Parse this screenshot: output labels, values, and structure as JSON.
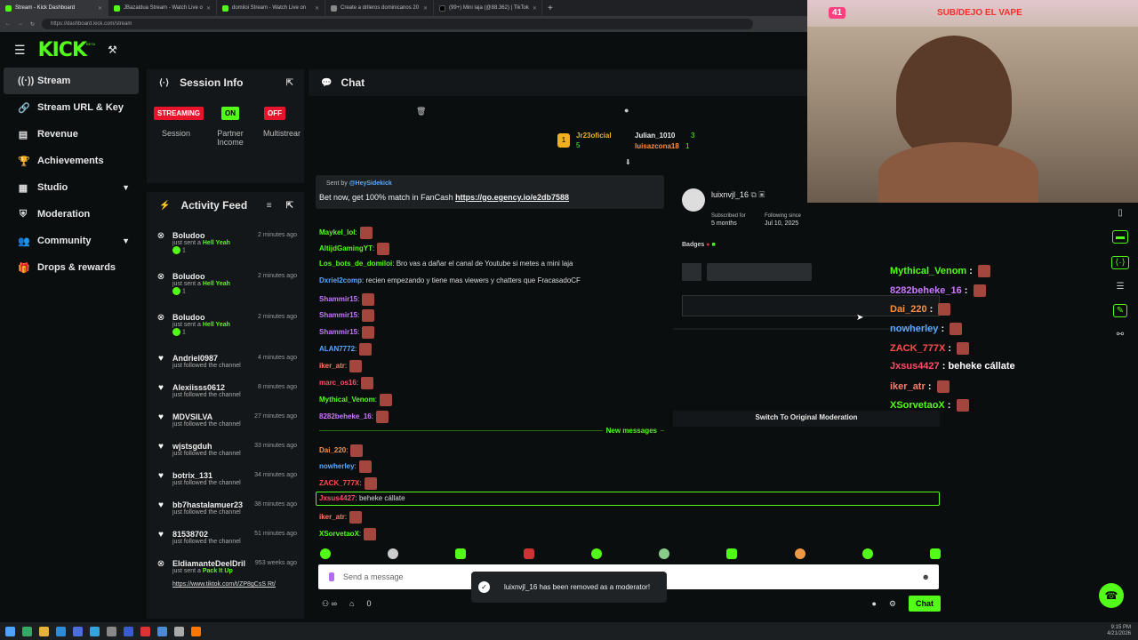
{
  "browser": {
    "tabs": [
      {
        "label": "Stream - Kick Dashboard"
      },
      {
        "label": "JBazaldua Stream - Watch Live o"
      },
      {
        "label": "domiloi Stream - Watch Live on"
      },
      {
        "label": "Create a drileros dominicanos 20"
      },
      {
        "label": "(99+) Mini laja (@88.362) | TikTok"
      }
    ],
    "url": "https://dashboard.kick.com/stream"
  },
  "topnav": {
    "logo": "KICK",
    "beta": "BETA"
  },
  "sidebar": {
    "items": [
      {
        "label": "Stream",
        "icon": "broadcast-icon"
      },
      {
        "label": "Stream URL & Key",
        "icon": "link-icon"
      },
      {
        "label": "Revenue",
        "icon": "chart-icon"
      },
      {
        "label": "Achievements",
        "icon": "trophy-icon"
      },
      {
        "label": "Studio",
        "icon": "studio-icon"
      },
      {
        "label": "Moderation",
        "icon": "shield-icon"
      },
      {
        "label": "Community",
        "icon": "users-icon"
      },
      {
        "label": "Drops & rewards",
        "icon": "gift-icon"
      }
    ]
  },
  "session": {
    "title": "Session Info",
    "streaming_badge": "STREAMING",
    "streaming_label": "Session",
    "partner_badge": "ON",
    "partner_label": "Partner Income",
    "multi_badge": "OFF",
    "multi_label": "Multistrear"
  },
  "activity": {
    "title": "Activity Feed",
    "items": [
      {
        "name": "Boludoo",
        "sub": "just sent a",
        "gift": "Hell Yeah",
        "count": "1",
        "time": "2 minutes ago",
        "icon": "kick-icon"
      },
      {
        "name": "Boludoo",
        "sub": "just sent a",
        "gift": "Hell Yeah",
        "count": "1",
        "time": "2 minutes ago",
        "icon": "kick-icon"
      },
      {
        "name": "Boludoo",
        "sub": "just sent a",
        "gift": "Hell Yeah",
        "count": "1",
        "time": "2 minutes ago",
        "icon": "kick-icon"
      },
      {
        "name": "Andriel0987",
        "sub": "just followed the channel",
        "time": "4 minutes ago",
        "icon": "heart-icon"
      },
      {
        "name": "Alexiisss0612",
        "sub": "just followed the channel",
        "time": "8 minutes ago",
        "icon": "heart-icon"
      },
      {
        "name": "MDVSILVA",
        "sub": "just followed the channel",
        "time": "27 minutes ago",
        "icon": "heart-icon"
      },
      {
        "name": "wjstsgduh",
        "sub": "just followed the channel",
        "time": "33 minutes ago",
        "icon": "heart-icon"
      },
      {
        "name": "botrix_131",
        "sub": "just followed the channel",
        "time": "34 minutes ago",
        "icon": "heart-icon"
      },
      {
        "name": "bb7hastalamuer23",
        "sub": "just followed the channel",
        "time": "38 minutes ago",
        "icon": "heart-icon"
      },
      {
        "name": "81538702",
        "sub": "just followed the channel",
        "time": "51 minutes ago",
        "icon": "heart-icon"
      },
      {
        "name": "EldiamanteDeelDril",
        "sub": "just sent a",
        "gift": "Pack It Up",
        "time": "953 weeks ago",
        "icon": "kick-icon"
      }
    ],
    "link": "https://www.tiktok.com/t/ZP8gCsS Rt/"
  },
  "chat": {
    "title": "Chat",
    "top": [
      {
        "name": "Jr23oficial",
        "count": "5"
      },
      {
        "name": "Julian_1010",
        "count": "3"
      },
      {
        "name": "luisazcona18",
        "count": "1"
      }
    ],
    "sent_by_label": "Sent by",
    "sent_by_user": "@HeySidekick",
    "pinned_text": "Bet now, get 100% match in FanCash",
    "pinned_link": "https://go.egency.io/e2db7588",
    "messages": [
      {
        "user": "Maykel_lol",
        "text": "",
        "color": "#53fc18"
      },
      {
        "user": "AltijdGamingYT",
        "text": "",
        "color": "#53fc18"
      },
      {
        "user": "Los_bots_de_domiloi",
        "text": "Bro vas a dañar el canal de Youtube si metes a mini laja",
        "color": "#53fc18"
      },
      {
        "user": "Dxriel2comp",
        "text": "recien empezando y tiene mas viewers y chatters que FracasadoCF",
        "color": "#5aa8ff"
      },
      {
        "user": "Shammir15",
        "text": "",
        "color": "#c878ff"
      },
      {
        "user": "Shammir15",
        "text": "",
        "color": "#c878ff"
      },
      {
        "user": "Shammir15",
        "text": "",
        "color": "#c878ff"
      },
      {
        "user": "ALAN7772",
        "text": "",
        "color": "#5aa8ff"
      },
      {
        "user": "iker_atr",
        "text": "",
        "color": "#ff7b6b"
      },
      {
        "user": "marc_os16",
        "text": "",
        "color": "#ff4d6a"
      },
      {
        "user": "Mythical_Venom",
        "text": "",
        "color": "#53fc18"
      },
      {
        "user": "8282beheke_16",
        "text": "",
        "color": "#c878ff"
      }
    ],
    "new_messages": "New messages",
    "messages2": [
      {
        "user": "Dai_220",
        "text": "",
        "color": "#ff8f3f"
      },
      {
        "user": "nowherley",
        "text": "",
        "color": "#5aa8ff"
      },
      {
        "user": "ZACK_777X",
        "text": "",
        "color": "#ff4d4d"
      },
      {
        "user": "Jxsus4427",
        "text": "beheke cállate",
        "color": "#ff4d6a"
      },
      {
        "user": "iker_atr",
        "text": "",
        "color": "#ff7b6b"
      },
      {
        "user": "XSorvetaoX",
        "text": "",
        "color": "#53fc18"
      }
    ],
    "input_placeholder": "Send a message",
    "footer_count": "0",
    "chat_button": "Chat"
  },
  "usercard": {
    "username": "luixnvjl_16",
    "subscribed_label": "Subscribed for",
    "subscribed_value": "5 months",
    "following_label": "Following since",
    "following_value": "Jul 10, 2025",
    "badges_label": "Badges",
    "switch_label": "Switch To Original Moderation"
  },
  "overlay": {
    "banner": "SUB/DEJO EL VAPE",
    "counter": "41",
    "chat": [
      {
        "user": "Mythical_Venom",
        "text": "",
        "color": "#53fc18"
      },
      {
        "user": "8282beheke_16",
        "text": "",
        "color": "#c878ff"
      },
      {
        "user": "Dai_220",
        "text": "",
        "color": "#ff8f3f"
      },
      {
        "user": "nowherley",
        "text": "",
        "color": "#5aa8ff"
      },
      {
        "user": "ZACK_777X",
        "text": "",
        "color": "#ff4d4d"
      },
      {
        "user": "Jxsus4427",
        "text": "beheke cállate",
        "color": "#ff4d6a"
      },
      {
        "user": "iker_atr",
        "text": "",
        "color": "#ff7b6b"
      },
      {
        "user": "XSorvetaoX",
        "text": "",
        "color": "#53fc18"
      }
    ]
  },
  "toast": {
    "text": "luixnvjl_16 has been removed as a moderator!"
  },
  "taskbar": {
    "time": "9:15 PM",
    "date": "4/21/2026"
  }
}
